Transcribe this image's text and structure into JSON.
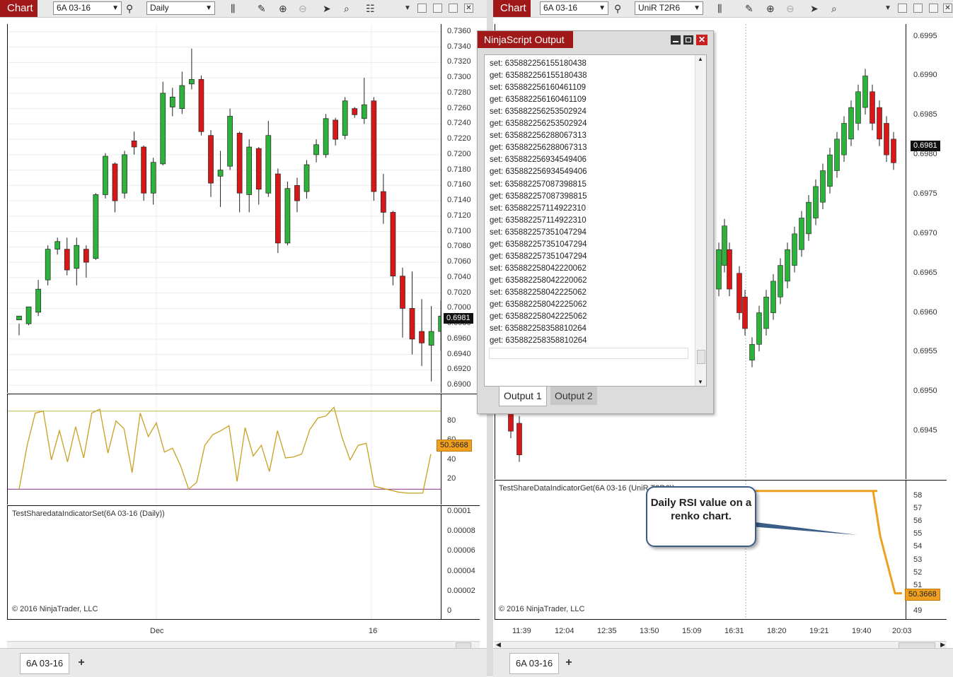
{
  "left": {
    "tag": "Chart",
    "instrument": "6A 03-16",
    "period": "Daily",
    "price_marker": "0.6981",
    "rsi_marker": "50.3668",
    "price_ticks": [
      "0.7360",
      "0.7340",
      "0.7320",
      "0.7300",
      "0.7280",
      "0.7260",
      "0.7240",
      "0.7220",
      "0.7200",
      "0.7180",
      "0.7160",
      "0.7140",
      "0.7120",
      "0.7100",
      "0.7080",
      "0.7060",
      "0.7040",
      "0.7020",
      "0.7000",
      "0.6980",
      "0.6960",
      "0.6940",
      "0.6920",
      "0.6900"
    ],
    "rsi_ticks": [
      "80",
      "60",
      "40",
      "20"
    ],
    "ind_ticks": [
      "0.0001",
      "0.00008",
      "0.00006",
      "0.00004",
      "0.00002",
      "0"
    ],
    "indicator_label": "TestSharedataIndicatorSet(6A 03-16 (Daily))",
    "copyright": "© 2016 NinjaTrader, LLC",
    "x_labels": [
      "Dec",
      "16"
    ],
    "tab": "6A 03-16",
    "tab_add": "+"
  },
  "right": {
    "tag": "Chart",
    "instrument": "6A 03-16",
    "period": "UniR T2R6",
    "price_marker": "0.6981",
    "ind_marker": "50.3668",
    "price_ticks": [
      "0.6995",
      "0.6990",
      "0.6985",
      "0.6980",
      "0.6975",
      "0.6970",
      "0.6965",
      "0.6960",
      "0.6955",
      "0.6950",
      "0.6945"
    ],
    "ind_ticks": [
      "58",
      "57",
      "56",
      "55",
      "54",
      "53",
      "52",
      "51",
      "50",
      "49"
    ],
    "indicator_label": "TestShareDataIndicatorGet(6A 03-16 (UniR T2R6))",
    "copyright": "© 2016 NinjaTrader, LLC",
    "x_labels": [
      "11:39",
      "12:04",
      "12:35",
      "13:50",
      "15:09",
      "16:31",
      "18:20",
      "19:21",
      "19:40",
      "20:03"
    ],
    "tab": "6A 03-16",
    "tab_add": "+"
  },
  "output_window": {
    "title": "NinjaScript Output",
    "lines": [
      "set: 635882256155180438",
      "get: 635882256155180438",
      "set: 635882256160461109",
      "get: 635882256160461109",
      "set: 635882256253502924",
      "get: 635882256253502924",
      "set: 635882256288067313",
      "get: 635882256288067313",
      "set: 635882256934549406",
      "get: 635882256934549406",
      "set: 635882257087398815",
      "get: 635882257087398815",
      "set: 635882257114922310",
      "get: 635882257114922310",
      "set: 635882257351047294",
      "get: 635882257351047294",
      "get: 635882257351047294",
      "set: 635882258042220062",
      "get: 635882258042220062",
      "set: 635882258042225062",
      "get: 635882258042225062",
      "get: 635882258042225062",
      "set: 635882258358810264",
      "get: 635882258358810264"
    ],
    "tabs": [
      "Output 1",
      "Output 2"
    ]
  },
  "callout": {
    "text": "Daily RSI value on a renko chart."
  },
  "colors": {
    "up": "#2db33c",
    "down": "#d81818",
    "rsi": "#c8a020",
    "orange": "#f0a020",
    "brand": "#a01818"
  },
  "chart_data": [
    {
      "type": "candlestick",
      "title": "",
      "ylim": [
        0.689,
        0.737
      ],
      "candles": [
        [
          0.6985,
          0.699,
          0.698,
          0.6965
        ],
        [
          0.698,
          0.7002,
          0.6998,
          0.6978
        ],
        [
          0.6995,
          0.7025,
          0.7037,
          0.699
        ],
        [
          0.7037,
          0.7077,
          0.7082,
          0.703
        ],
        [
          0.7077,
          0.7087,
          0.7092,
          0.707
        ],
        [
          0.7077,
          0.705,
          0.7092,
          0.7043
        ],
        [
          0.7052,
          0.7082,
          0.7092,
          0.703
        ],
        [
          0.7077,
          0.706,
          0.7082,
          0.704
        ],
        [
          0.7065,
          0.7148,
          0.715,
          0.7063
        ],
        [
          0.7148,
          0.7198,
          0.7202,
          0.7143
        ],
        [
          0.7188,
          0.714,
          0.719,
          0.7125
        ],
        [
          0.715,
          0.72,
          0.7205,
          0.7143
        ],
        [
          0.7218,
          0.721,
          0.723,
          0.72
        ],
        [
          0.721,
          0.715,
          0.7212,
          0.714
        ],
        [
          0.715,
          0.719,
          0.7196,
          0.7135
        ],
        [
          0.7188,
          0.728,
          0.7295,
          0.7186
        ],
        [
          0.7262,
          0.7275,
          0.7287,
          0.725
        ],
        [
          0.726,
          0.729,
          0.7308,
          0.7253
        ],
        [
          0.7292,
          0.7298,
          0.7338,
          0.7285
        ],
        [
          0.7298,
          0.723,
          0.7303,
          0.7225
        ],
        [
          0.7225,
          0.7163,
          0.7232,
          0.7145
        ],
        [
          0.7172,
          0.718,
          0.7205,
          0.7132
        ],
        [
          0.7185,
          0.725,
          0.726,
          0.718
        ],
        [
          0.7228,
          0.715,
          0.723,
          0.7125
        ],
        [
          0.7148,
          0.721,
          0.722,
          0.7125
        ],
        [
          0.7208,
          0.7155,
          0.721,
          0.7135
        ],
        [
          0.715,
          0.7225,
          0.7244,
          0.7145
        ],
        [
          0.7175,
          0.7085,
          0.7182,
          0.7072
        ],
        [
          0.7085,
          0.7156,
          0.7165,
          0.7082
        ],
        [
          0.716,
          0.714,
          0.717,
          0.7125
        ],
        [
          0.7152,
          0.7187,
          0.7193,
          0.7143
        ],
        [
          0.72,
          0.7213,
          0.722,
          0.719
        ],
        [
          0.72,
          0.7247,
          0.7253,
          0.7196
        ],
        [
          0.7245,
          0.722,
          0.7248,
          0.7212
        ],
        [
          0.7225,
          0.727,
          0.7275,
          0.722
        ],
        [
          0.726,
          0.7252,
          0.7262,
          0.7248
        ],
        [
          0.7247,
          0.7265,
          0.73,
          0.724
        ],
        [
          0.727,
          0.7152,
          0.7275,
          0.714
        ],
        [
          0.7152,
          0.7125,
          0.7175,
          0.711
        ],
        [
          0.7125,
          0.7042,
          0.7127,
          0.703
        ],
        [
          0.7042,
          0.7,
          0.7053,
          0.6962
        ],
        [
          0.7,
          0.696,
          0.7048,
          0.694
        ],
        [
          0.697,
          0.6955,
          0.7012,
          0.6925
        ],
        [
          0.6952,
          0.697,
          0.7003,
          0.6905
        ],
        [
          0.697,
          0.699,
          0.701,
          0.6945
        ]
      ]
    },
    {
      "type": "line",
      "name": "RSI",
      "ylim": [
        0,
        100
      ],
      "ref_lines": [
        90,
        10
      ],
      "values": [
        10,
        55,
        88,
        90,
        40,
        70,
        38,
        74,
        42,
        88,
        92,
        47,
        80,
        72,
        27,
        88,
        64,
        78,
        48,
        52,
        34,
        10,
        17,
        55,
        66,
        70,
        75,
        18,
        73,
        44,
        55,
        28,
        70,
        42,
        43,
        46,
        71,
        83,
        85,
        94,
        63,
        40,
        55,
        57,
        13,
        11,
        9,
        7,
        6,
        6,
        6,
        46
      ]
    },
    {
      "type": "line",
      "name": "",
      "ylim": [
        48.5,
        59
      ],
      "values": [
        58.4,
        58.4,
        58.4,
        58.4,
        58.4,
        58.4,
        58.4,
        58.4,
        58.4,
        54.9,
        50.4,
        50.4
      ]
    }
  ]
}
